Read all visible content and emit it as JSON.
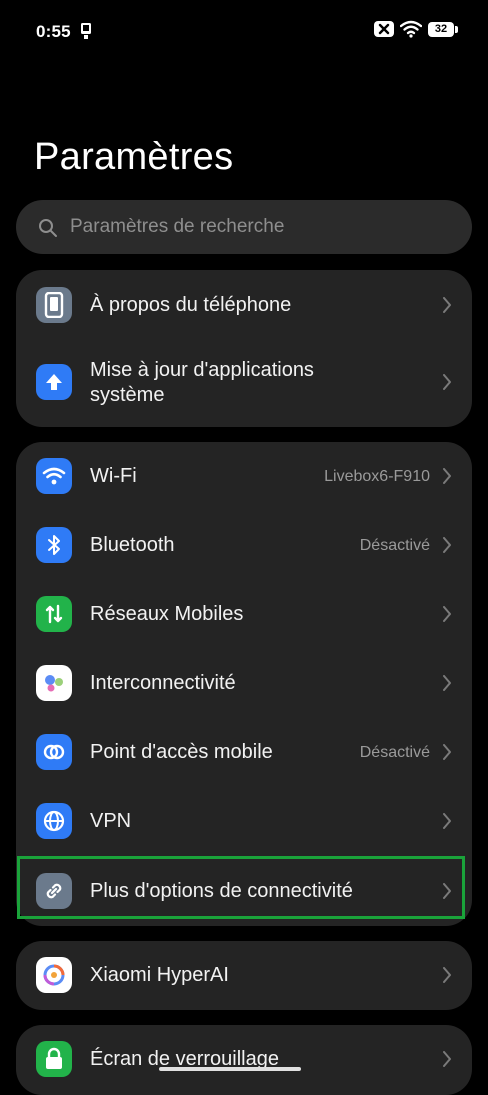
{
  "status_bar": {
    "time": "0:55",
    "battery": "32"
  },
  "page": {
    "title": "Paramètres"
  },
  "search": {
    "placeholder": "Paramètres de recherche"
  },
  "groups": {
    "device": [
      {
        "label": "À propos du téléphone",
        "icon": "phone-icon",
        "color": "#6b7a8c"
      },
      {
        "label_line1": "Mise à jour d'applications",
        "label_line2": "système",
        "icon": "arrow-up-icon",
        "color": "#2f7bf6"
      }
    ],
    "connectivity": [
      {
        "label": "Wi-Fi",
        "value": "Livebox6-F910",
        "icon": "wifi-icon",
        "color": "#2f7bf6"
      },
      {
        "label": "Bluetooth",
        "value": "Désactivé",
        "icon": "bluetooth-icon",
        "color": "#2f7bf6"
      },
      {
        "label": "Réseaux Mobiles",
        "icon": "mobile-data-icon",
        "color": "#22b34a"
      },
      {
        "label": "Interconnectivité",
        "icon": "interconnectivity-icon",
        "color": "#ffffff"
      },
      {
        "label": "Point d'accès mobile",
        "value": "Désactivé",
        "icon": "hotspot-icon",
        "color": "#2f7bf6"
      },
      {
        "label": "VPN",
        "icon": "globe-icon",
        "color": "#2f7bf6"
      },
      {
        "label": "Plus d'options de connectivité",
        "icon": "link-icon",
        "color": "#6b7a8c"
      }
    ],
    "ai": [
      {
        "label": "Xiaomi HyperAI",
        "icon": "hyperai-icon",
        "color": "#ffffff"
      }
    ],
    "lock": [
      {
        "label": "Écran de verrouillage",
        "icon": "lock-icon",
        "color": "#22b34a"
      }
    ]
  }
}
